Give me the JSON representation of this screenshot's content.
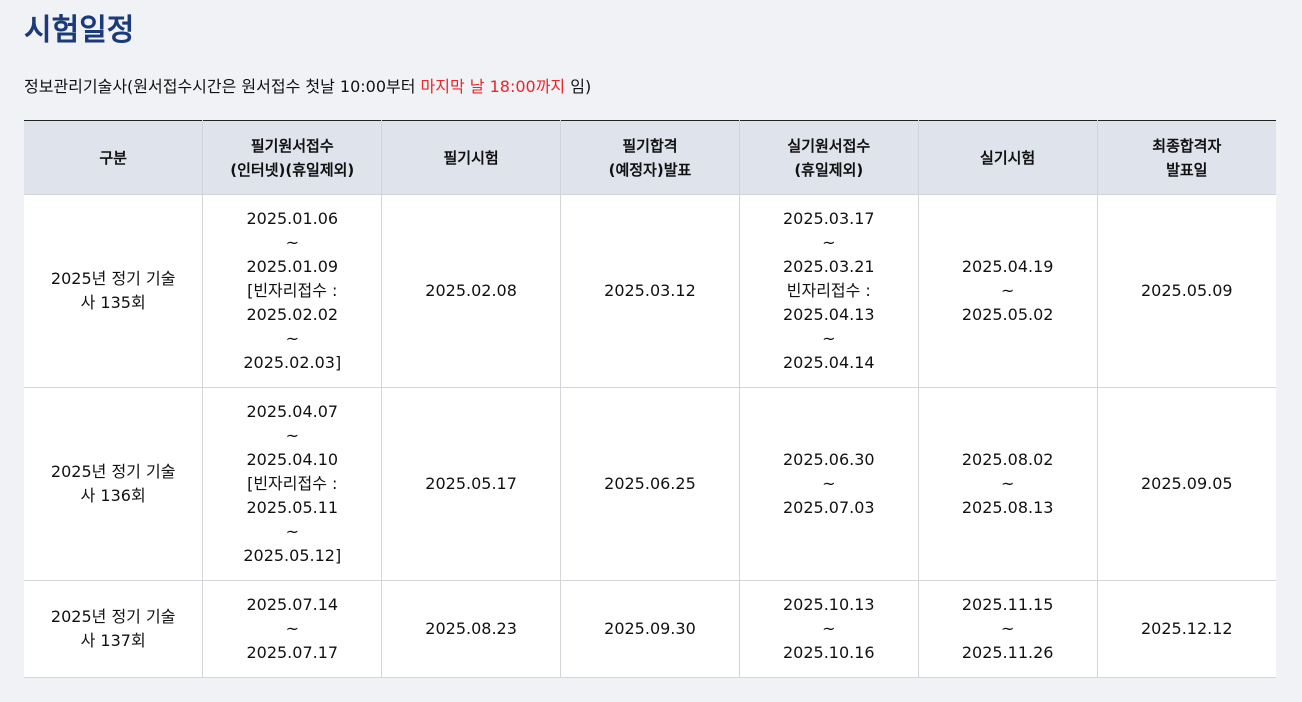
{
  "title": "시험일정",
  "notice": {
    "prefix": "정보관리기술사(원서접수시간은 원서접수 첫날 10:00부터 ",
    "highlight": "마지막 날 18:00까지",
    "suffix": " 임)"
  },
  "colors": {
    "title": "#1b3a7a",
    "highlight": "#e8262b",
    "header_bg": "#dfe3ec",
    "page_bg": "#f1f2f6"
  },
  "table": {
    "headers": [
      [
        "구분"
      ],
      [
        "필기원서접수",
        "(인터넷)(휴일제외)"
      ],
      [
        "필기시험"
      ],
      [
        "필기합격",
        "(예정자)발표"
      ],
      [
        "실기원서접수",
        "(휴일제외)"
      ],
      [
        "실기시험"
      ],
      [
        "최종합격자",
        "발표일"
      ]
    ],
    "rows": [
      [
        [
          "2025년 정기 기술",
          "사 135회"
        ],
        [
          "2025.01.06",
          "~",
          "2025.01.09",
          "[빈자리접수 :",
          "2025.02.02",
          "~",
          "2025.02.03]"
        ],
        [
          "2025.02.08"
        ],
        [
          "2025.03.12"
        ],
        [
          "2025.03.17",
          "~",
          "2025.03.21",
          "빈자리접수 :",
          "2025.04.13",
          "~",
          "2025.04.14"
        ],
        [
          "2025.04.19",
          "~",
          "2025.05.02"
        ],
        [
          "2025.05.09"
        ]
      ],
      [
        [
          "2025년 정기 기술",
          "사 136회"
        ],
        [
          "2025.04.07",
          "~",
          "2025.04.10",
          "[빈자리접수 :",
          "2025.05.11",
          "~",
          "2025.05.12]"
        ],
        [
          "2025.05.17"
        ],
        [
          "2025.06.25"
        ],
        [
          "2025.06.30",
          "~",
          "2025.07.03"
        ],
        [
          "2025.08.02",
          "~",
          "2025.08.13"
        ],
        [
          "2025.09.05"
        ]
      ],
      [
        [
          "2025년 정기 기술",
          "사 137회"
        ],
        [
          "2025.07.14",
          "~",
          "2025.07.17"
        ],
        [
          "2025.08.23"
        ],
        [
          "2025.09.30"
        ],
        [
          "2025.10.13",
          "~",
          "2025.10.16"
        ],
        [
          "2025.11.15",
          "~",
          "2025.11.26"
        ],
        [
          "2025.12.12"
        ]
      ]
    ]
  }
}
